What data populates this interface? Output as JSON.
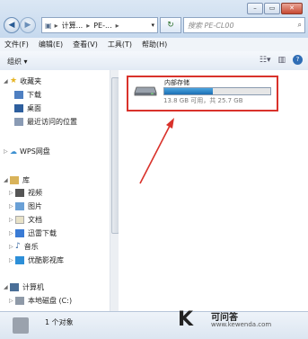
{
  "titlebar": {
    "breadcrumb": [
      "计算...",
      "PE-..."
    ],
    "search_placeholder": "搜索 PE-CL00",
    "window_buttons": [
      "minimize",
      "maximize",
      "close"
    ]
  },
  "menu": [
    "文件(F)",
    "编辑(E)",
    "查看(V)",
    "工具(T)",
    "帮助(H)"
  ],
  "toolbar": {
    "organize_label": "组织 ▾"
  },
  "navpane": {
    "favorites": {
      "label": "收藏夹",
      "items": [
        "下载",
        "桌面",
        "最近访问的位置"
      ]
    },
    "wps": "WPS网盘",
    "library": {
      "label": "库",
      "items": [
        "视频",
        "图片",
        "文档",
        "迅雷下载",
        "音乐",
        "优酷影视库"
      ]
    },
    "computer": {
      "label": "计算机",
      "items": [
        "本地磁盘 (C:)"
      ]
    }
  },
  "drive": {
    "name": "内部存储",
    "used_fraction": 0.46,
    "space_text": "13.8 GB 可用，共 25.7 GB"
  },
  "status": {
    "text": "1 个对象"
  },
  "watermark": {
    "brand": "K",
    "title": "可问答",
    "url": "www.kewenda.com"
  },
  "colors": {
    "highlight_box": "#d9322b",
    "progress": "#1c6fb3"
  }
}
